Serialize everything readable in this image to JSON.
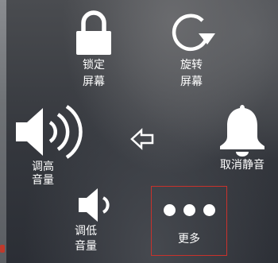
{
  "menu": {
    "lock_screen": {
      "label_line1": "锁定",
      "label_line2": "屏幕",
      "icon": "lock-icon"
    },
    "rotate_screen": {
      "label_line1": "旋转",
      "label_line2": "屏幕",
      "icon": "rotate-icon"
    },
    "volume_up": {
      "label_line1": "调高",
      "label_line2": "音量",
      "icon": "speaker-loud-icon"
    },
    "back": {
      "icon": "back-arrow-icon"
    },
    "unmute": {
      "label": "取消静音",
      "icon": "bell-icon"
    },
    "volume_down": {
      "label_line1": "调低",
      "label_line2": "音量",
      "icon": "speaker-low-icon"
    },
    "more": {
      "label": "更多",
      "icon": "ellipsis-icon"
    }
  },
  "colors": {
    "highlight_border": "#c8322c",
    "icon": "#ffffff"
  }
}
